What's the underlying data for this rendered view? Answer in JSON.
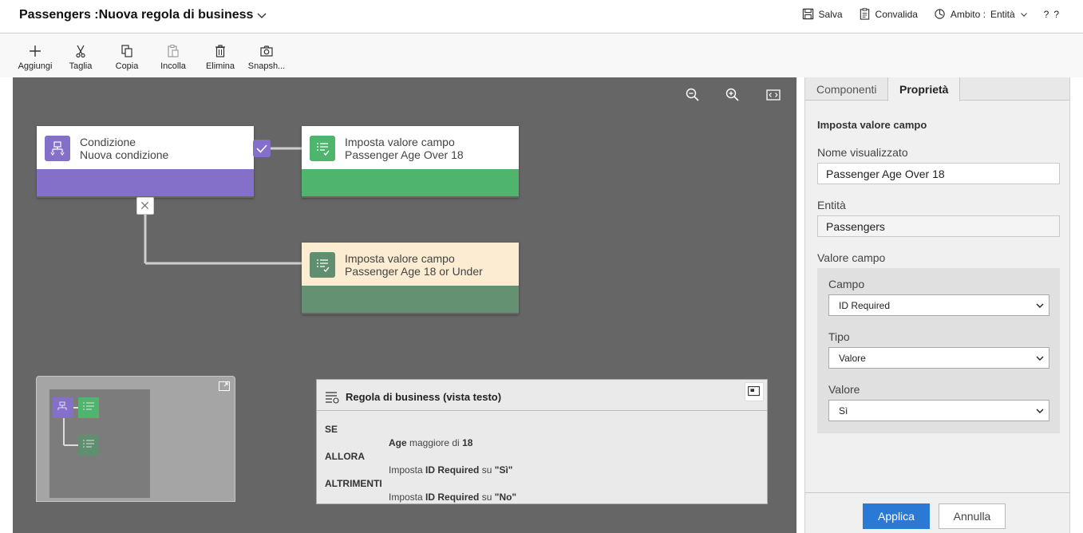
{
  "header": {
    "title": "Passengers :Nuova regola di business",
    "save": "Salva",
    "validate": "Convalida",
    "scope_label": "Ambito :",
    "scope_value": "Entità",
    "help": "?"
  },
  "toolbar": {
    "add": "Aggiungi",
    "cut": "Taglia",
    "copy": "Copia",
    "paste": "Incolla",
    "delete": "Elimina",
    "snapshot": "Snapsh..."
  },
  "canvas": {
    "condition": {
      "line1": "Condizione",
      "line2": "Nuova condizione"
    },
    "action_true": {
      "line1": "Imposta valore campo",
      "line2": "Passenger Age Over 18"
    },
    "action_false": {
      "line1": "Imposta valore campo",
      "line2": "Passenger Age 18 or Under"
    }
  },
  "text_view": {
    "title": "Regola di business (vista testo)",
    "kw_if": "SE",
    "if_field": "Age",
    "if_op": "maggiore di",
    "if_value": "18",
    "kw_then": "ALLORA",
    "then_prefix": "Imposta",
    "then_field": "ID Required",
    "then_mid": "su",
    "then_value": "\"Sì\"",
    "kw_else": "ALTRIMENTI",
    "else_prefix": "Imposta",
    "else_field": "ID Required",
    "else_mid": "su",
    "else_value": "\"No\""
  },
  "panel": {
    "tab_components": "Componenti",
    "tab_properties": "Proprietà",
    "heading": "Imposta valore campo",
    "display_name_label": "Nome visualizzato",
    "display_name_value": "Passenger Age Over 18",
    "entity_label": "Entità",
    "entity_value": "Passengers",
    "field_value_label": "Valore campo",
    "field_label": "Campo",
    "field_selected": "ID Required",
    "type_label": "Tipo",
    "type_selected": "Valore",
    "value_label": "Valore",
    "value_selected": "Sì",
    "apply": "Applica",
    "cancel": "Annulla"
  },
  "colors": {
    "condition": "#8470c9",
    "action": "#4fb56e",
    "action_dark": "#5f8f6f",
    "primary": "#2a7ad5"
  }
}
